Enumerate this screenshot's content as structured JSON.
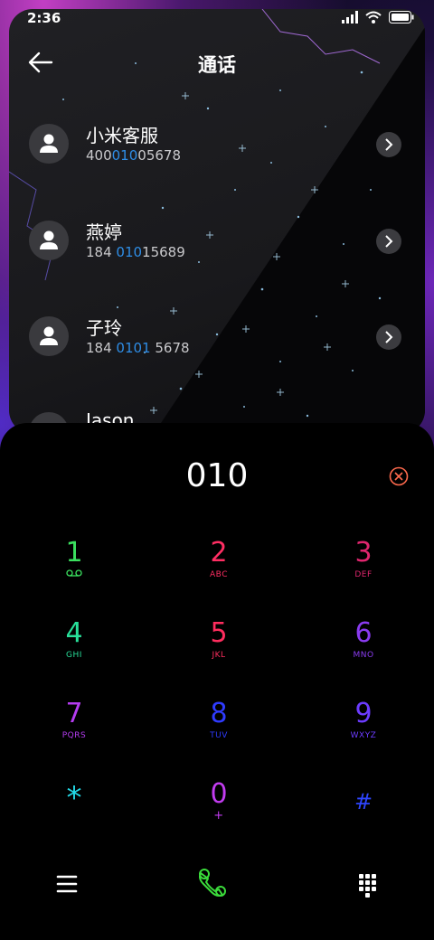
{
  "status": {
    "time": "2:36"
  },
  "header": {
    "title": "通话"
  },
  "contacts": [
    {
      "name": "小米客服",
      "num_pre": "400",
      "num_hl": "010",
      "num_post": "05678"
    },
    {
      "name": "燕婷",
      "num_pre": "184 ",
      "num_hl": "010",
      "num_post": "15689"
    },
    {
      "name": "子玲",
      "num_pre": "184 ",
      "num_hl": "0101",
      "num_post": " 5678"
    },
    {
      "name": "Jason"
    }
  ],
  "dialer": {
    "input": "010",
    "keys": [
      {
        "digit": "1",
        "letters": "",
        "color": "#3be05f"
      },
      {
        "digit": "2",
        "letters": "ABC",
        "color": "#ff2e63"
      },
      {
        "digit": "3",
        "letters": "DEF",
        "color": "#e0266e"
      },
      {
        "digit": "4",
        "letters": "GHI",
        "color": "#28e09a"
      },
      {
        "digit": "5",
        "letters": "JKL",
        "color": "#ff2d5e"
      },
      {
        "digit": "6",
        "letters": "MNO",
        "color": "#8a3bf0"
      },
      {
        "digit": "7",
        "letters": "PQRS",
        "color": "#b43cf0"
      },
      {
        "digit": "8",
        "letters": "TUV",
        "color": "#2f3bff"
      },
      {
        "digit": "9",
        "letters": "WXYZ",
        "color": "#6c3cff"
      },
      {
        "digit": "*",
        "letters": "",
        "color": "#23d8e6"
      },
      {
        "digit": "0",
        "letters": "+",
        "color": "#c23cf0"
      },
      {
        "digit": "#",
        "letters": "",
        "color": "#2e45ff"
      }
    ]
  },
  "colors": {
    "highlight": "#2e8de6",
    "clear": "#ff6a4d",
    "call": "#3bdc3b"
  },
  "icons": [
    "back-arrow-icon",
    "chevron-right-icon",
    "avatar-person-icon",
    "voicemail-icon",
    "clear-icon",
    "menu-icon",
    "call-icon",
    "keypad-icon",
    "signal-icon",
    "wifi-icon",
    "battery-icon"
  ]
}
